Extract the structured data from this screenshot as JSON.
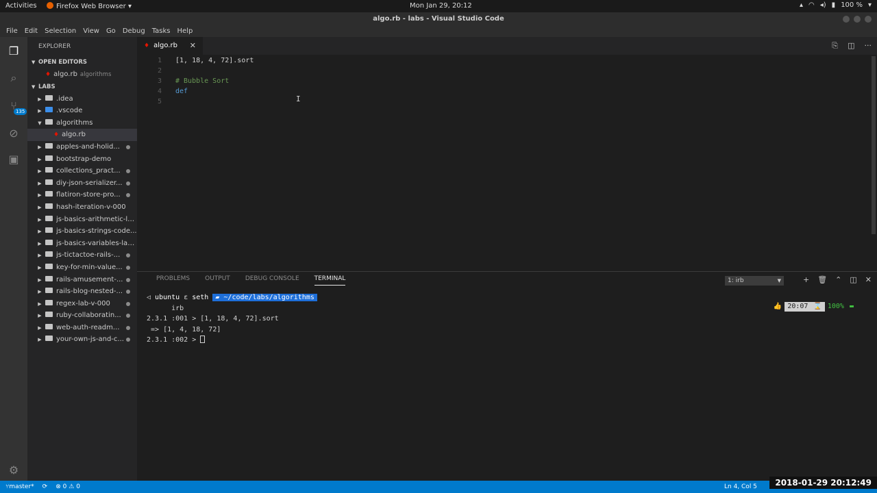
{
  "topbar": {
    "activities": "Activities",
    "app_name": "Firefox Web Browser",
    "clock": "Mon Jan 29, 20:12",
    "battery": "100 %"
  },
  "window": {
    "title": "algo.rb - labs - Visual Studio Code"
  },
  "menu": [
    "File",
    "Edit",
    "Selection",
    "View",
    "Go",
    "Debug",
    "Tasks",
    "Help"
  ],
  "activitybar": {
    "scm_badge": "135"
  },
  "explorer": {
    "title": "EXPLORER",
    "open_editors_label": "OPEN EDITORS",
    "open_editor": {
      "name": "algo.rb",
      "folder": "algorithms"
    },
    "workspace_label": "LABS",
    "items": [
      {
        "name": ".idea",
        "type": "folder",
        "depth": 1,
        "expanded": false,
        "modified": false
      },
      {
        "name": ".vscode",
        "type": "folder-blue",
        "depth": 1,
        "expanded": false,
        "modified": false
      },
      {
        "name": "algorithms",
        "type": "folder",
        "depth": 1,
        "expanded": true,
        "modified": false
      },
      {
        "name": "algo.rb",
        "type": "ruby",
        "depth": 2,
        "expanded": false,
        "modified": false,
        "selected": true
      },
      {
        "name": "apples-and-holid...",
        "type": "folder",
        "depth": 1,
        "expanded": false,
        "modified": true
      },
      {
        "name": "bootstrap-demo",
        "type": "folder",
        "depth": 1,
        "expanded": false,
        "modified": false
      },
      {
        "name": "collections_pract...",
        "type": "folder",
        "depth": 1,
        "expanded": false,
        "modified": true
      },
      {
        "name": "diy-json-serializer...",
        "type": "folder",
        "depth": 1,
        "expanded": false,
        "modified": true
      },
      {
        "name": "flatiron-store-pro...",
        "type": "folder",
        "depth": 1,
        "expanded": false,
        "modified": true
      },
      {
        "name": "hash-iteration-v-000",
        "type": "folder",
        "depth": 1,
        "expanded": false,
        "modified": false
      },
      {
        "name": "js-basics-arithmetic-la...",
        "type": "folder",
        "depth": 1,
        "expanded": false,
        "modified": false
      },
      {
        "name": "js-basics-strings-code...",
        "type": "folder",
        "depth": 1,
        "expanded": false,
        "modified": false
      },
      {
        "name": "js-basics-variables-lab...",
        "type": "folder",
        "depth": 1,
        "expanded": false,
        "modified": false
      },
      {
        "name": "js-tictactoe-rails-...",
        "type": "folder",
        "depth": 1,
        "expanded": false,
        "modified": true
      },
      {
        "name": "key-for-min-value...",
        "type": "folder",
        "depth": 1,
        "expanded": false,
        "modified": true
      },
      {
        "name": "rails-amusement-...",
        "type": "folder",
        "depth": 1,
        "expanded": false,
        "modified": true
      },
      {
        "name": "rails-blog-nested-...",
        "type": "folder",
        "depth": 1,
        "expanded": false,
        "modified": true
      },
      {
        "name": "regex-lab-v-000",
        "type": "folder",
        "depth": 1,
        "expanded": false,
        "modified": true
      },
      {
        "name": "ruby-collaboratin...",
        "type": "folder",
        "depth": 1,
        "expanded": false,
        "modified": true
      },
      {
        "name": "web-auth-readm...",
        "type": "folder",
        "depth": 1,
        "expanded": false,
        "modified": true
      },
      {
        "name": "your-own-js-and-c...",
        "type": "folder",
        "depth": 1,
        "expanded": false,
        "modified": true
      }
    ]
  },
  "editor": {
    "tab_name": "algo.rb",
    "lines": [
      {
        "num": "1",
        "text": "[1, 18, 4, 72].sort",
        "kind": "code"
      },
      {
        "num": "2",
        "text": "",
        "kind": "code"
      },
      {
        "num": "3",
        "text": "# Bubble Sort",
        "kind": "cmt"
      },
      {
        "num": "4",
        "text": "def",
        "kind": "kw"
      },
      {
        "num": "5",
        "text": "",
        "kind": "code"
      }
    ]
  },
  "panel": {
    "tabs": [
      "PROBLEMS",
      "OUTPUT",
      "DEBUG CONSOLE",
      "TERMINAL"
    ],
    "active_tab": "TERMINAL",
    "terminal_select": "1: irb",
    "prompt_user": "ubuntu",
    "prompt_host": "seth",
    "prompt_path": "~/code/labs/algorithms",
    "prompt_cmd": "irb",
    "lines": [
      "2.3.1 :001 > [1, 18, 4, 72].sort",
      " => [1, 4, 18, 72]",
      "2.3.1 :002 > "
    ],
    "rprompt_time": "20:07",
    "rprompt_battery": "100%"
  },
  "statusbar": {
    "branch": "master*",
    "errors": "0",
    "warnings": "0",
    "position": "Ln 4, Col 5"
  },
  "timestamp": "2018-01-29  20:12:49"
}
